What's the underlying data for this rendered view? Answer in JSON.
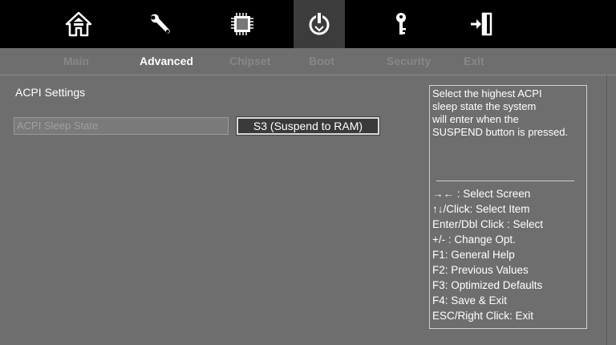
{
  "topbar": {
    "icons": [
      "home-icon",
      "wrench-icon",
      "chip-icon",
      "power-icon",
      "key-icon",
      "exit-icon"
    ],
    "active_index": 3
  },
  "menu": {
    "tabs": [
      {
        "label": "Main"
      },
      {
        "label": "Advanced"
      },
      {
        "label": "Chipset"
      },
      {
        "label": "Boot"
      },
      {
        "label": "Security"
      },
      {
        "label": "Exit"
      }
    ],
    "active": "Advanced"
  },
  "content": {
    "section_title": "ACPI Settings",
    "setting": {
      "label": "ACPI Sleep State",
      "value": "S3 (Suspend to RAM)"
    }
  },
  "help": {
    "description_lines": [
      "Select the highest ACPI",
      "sleep state the system",
      "will enter when the",
      "SUSPEND button is pressed."
    ],
    "keys": [
      "→←  : Select Screen",
      "↑↓/Click: Select Item",
      "Enter/Dbl Click : Select",
      "+/- : Change Opt.",
      "F1: General Help",
      "F2: Previous Values",
      "F3: Optimized Defaults",
      "F4: Save & Exit",
      "ESC/Right Click: Exit"
    ]
  },
  "colors": {
    "background": "#6e6e6e",
    "topbar": "#000000",
    "active_tab": "#ffffff",
    "inactive_tab": "#878787"
  }
}
